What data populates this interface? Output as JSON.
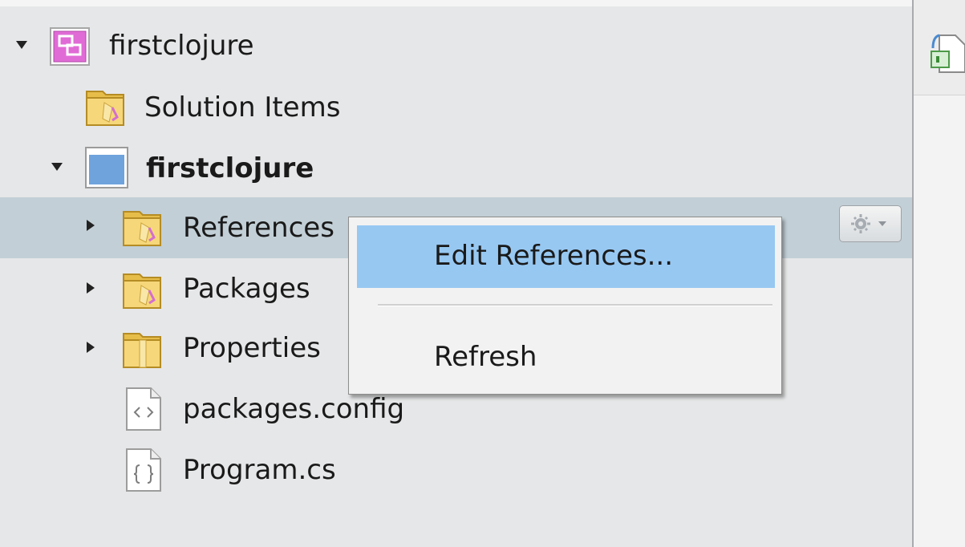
{
  "solution_tree": {
    "solution": {
      "label": "firstclojure",
      "icon": "solution-icon",
      "expanded": true
    },
    "solution_items": {
      "label": "Solution Items",
      "icon": "folder-icon"
    },
    "project": {
      "label": "firstclojure",
      "icon": "project-icon",
      "expanded": true
    },
    "references": {
      "label": "References",
      "icon": "folder-icon",
      "selected": true
    },
    "packages": {
      "label": "Packages",
      "icon": "folder-icon"
    },
    "properties": {
      "label": "Properties",
      "icon": "folder-icon"
    },
    "packages_config": {
      "label": "packages.config",
      "icon": "xml-file-icon"
    },
    "program_cs": {
      "label": "Program.cs",
      "icon": "csharp-file-icon"
    }
  },
  "context_menu": {
    "items": [
      {
        "label": "Edit References...",
        "highlighted": true
      },
      {
        "label": "Refresh",
        "highlighted": false
      }
    ]
  },
  "colors": {
    "pane_background": "#e6e7e8",
    "selected_row": "#c2cfd6",
    "menu_highlight": "#97c8f2",
    "folder": "#f0cf6a"
  }
}
